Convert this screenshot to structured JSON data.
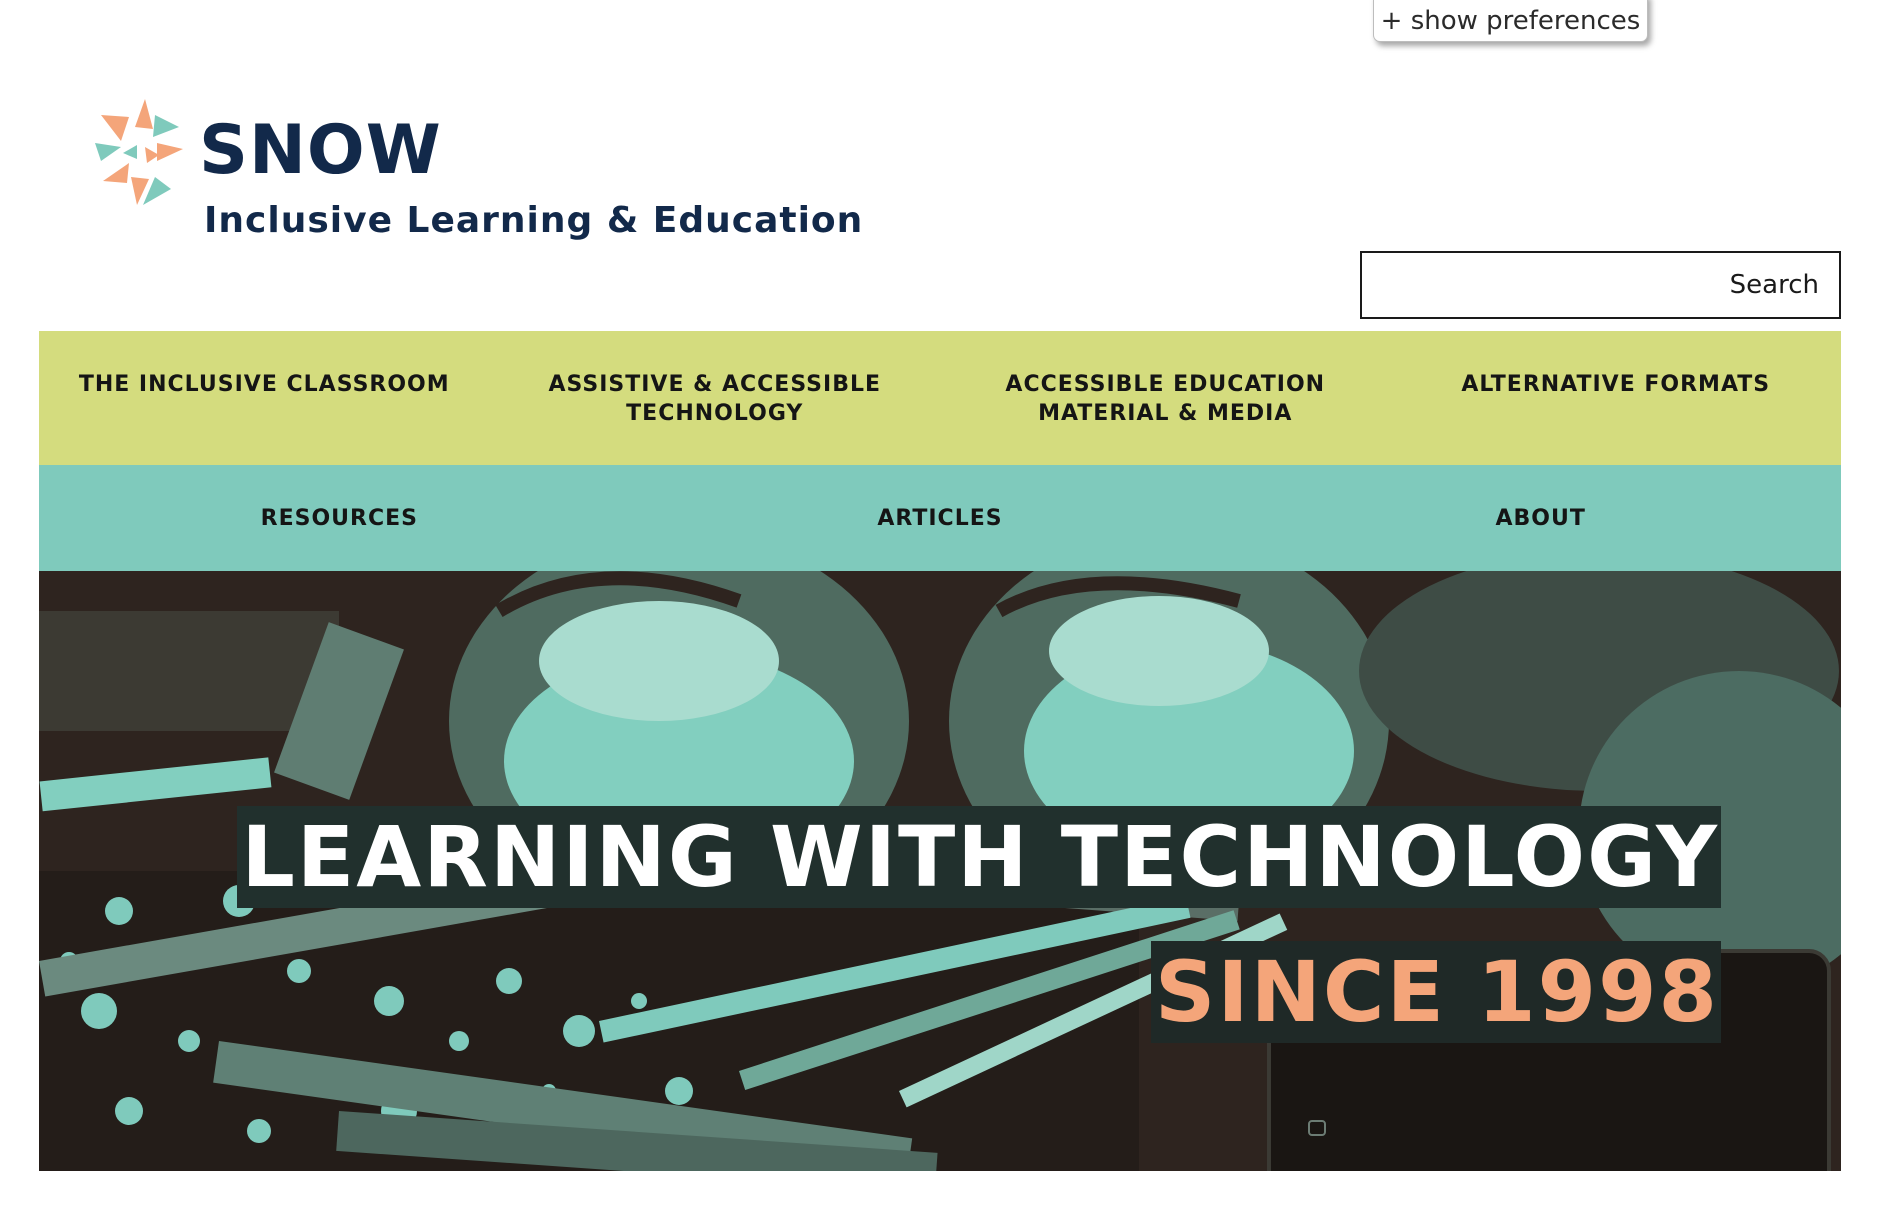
{
  "preferences": {
    "toggle_label": "+ show preferences"
  },
  "brand": {
    "name": "SNOW",
    "tagline": "Inclusive Learning & Education",
    "colors": {
      "navy": "#12294a",
      "peach": "#f4a57a",
      "teal": "#7fcabc"
    }
  },
  "search": {
    "placeholder": "Search",
    "value": ""
  },
  "nav_primary": {
    "background": "#d4dc7e",
    "items": [
      {
        "label": "THE INCLUSIVE CLASSROOM"
      },
      {
        "label": "ASSISTIVE & ACCESSIBLE\nTECHNOLOGY"
      },
      {
        "label": "ACCESSIBLE EDUCATION\nMATERIAL & MEDIA"
      },
      {
        "label": "ALTERNATIVE FORMATS"
      }
    ]
  },
  "nav_secondary": {
    "background": "#7fcabc",
    "items": [
      {
        "label": "RESOURCES"
      },
      {
        "label": "ARTICLES"
      },
      {
        "label": "ABOUT"
      }
    ]
  },
  "hero": {
    "headline": "LEARNING WITH TECHNOLOGY",
    "subheadline": "SINCE 1998",
    "subheadline_color": "#f4a57a",
    "image_icon": "sneakers-notebooks-pencils-photo"
  }
}
